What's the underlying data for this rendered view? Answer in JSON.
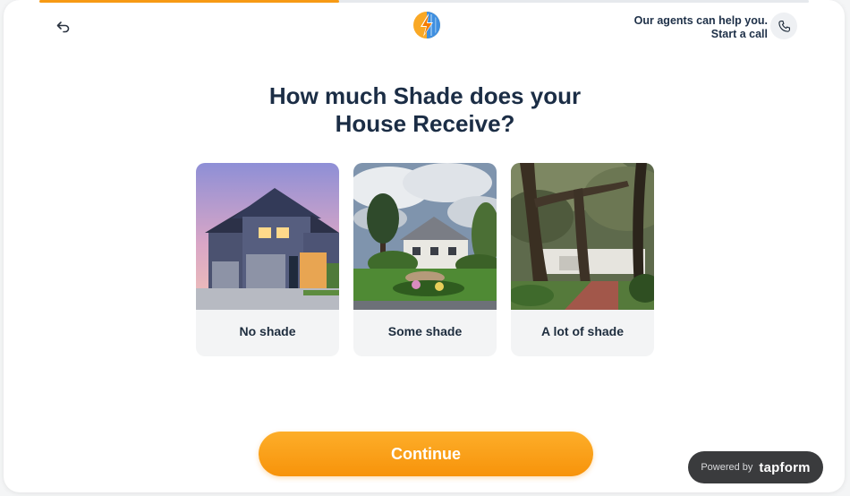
{
  "progress": {
    "fraction": 0.39
  },
  "header": {
    "back_icon": "back-arrow-icon",
    "logo_icon": "solar-bolt-logo-icon",
    "agents_line": "Our agents can help you.",
    "start_call": "Start a call",
    "phone_icon": "phone-icon"
  },
  "question": {
    "line1": "How much Shade does your",
    "line2": "House Receive?"
  },
  "options": [
    {
      "label": "No shade"
    },
    {
      "label": "Some shade"
    },
    {
      "label": "A lot of shade"
    }
  ],
  "continue_label": "Continue",
  "powered": {
    "by": "Powered by",
    "brand": "tapform"
  },
  "colors": {
    "accent": "#f7930a",
    "heading": "#1b2d45",
    "option_bg": "#f3f4f5",
    "badge_bg": "#3a3b3d"
  }
}
